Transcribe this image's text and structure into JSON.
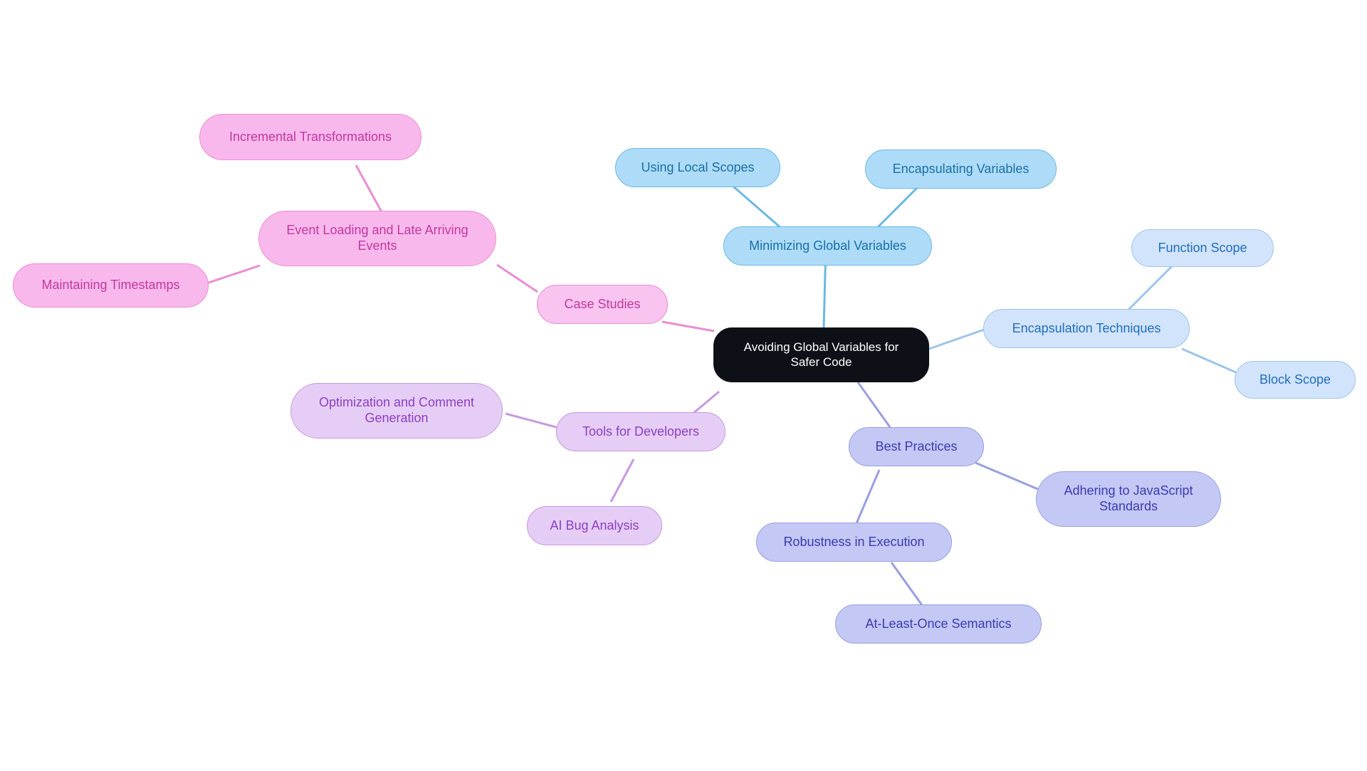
{
  "diagram": {
    "type": "mindmap",
    "title": "Avoiding Global Variables for Safer Code",
    "background": "#ffffff"
  },
  "palette": {
    "root_fill": "#0d1117",
    "root_text": "#ffffff",
    "blue_fill": "#aedcf8",
    "blue_text": "#1a6fa8",
    "blue_border": "#6cb8e4",
    "lightblue_fill": "#d2e4fb",
    "lightblue_text": "#1f6dbd",
    "lightblue_border": "#9dc4ea",
    "indigo_fill": "#c3c8f5",
    "indigo_text": "#3b3bb0",
    "indigo_border": "#9a9fe0",
    "violet_fill": "#e6cdf5",
    "violet_text": "#8b3fc4",
    "violet_border": "#c69ae0",
    "pink_fill": "#f9b8ec",
    "pink_text": "#c0399f",
    "pink_border": "#e88ed2",
    "pink_light_fill": "#f9c4ef",
    "pink_light_text": "#c0399f",
    "pink_light_border": "#e88ed2"
  },
  "nodes": {
    "root": {
      "label": "Avoiding Global Variables for\nSafer Code"
    },
    "minimizing_global_variables": {
      "label": "Minimizing Global Variables"
    },
    "using_local_scopes": {
      "label": "Using Local Scopes"
    },
    "encapsulating_variables": {
      "label": "Encapsulating Variables"
    },
    "encapsulation_techniques": {
      "label": "Encapsulation Techniques"
    },
    "function_scope": {
      "label": "Function Scope"
    },
    "block_scope": {
      "label": "Block Scope"
    },
    "best_practices": {
      "label": "Best Practices"
    },
    "adhering_to_javascript_standards": {
      "label": "Adhering to JavaScript\nStandards"
    },
    "robustness_in_execution": {
      "label": "Robustness in Execution"
    },
    "at_least_once_semantics": {
      "label": "At-Least-Once Semantics"
    },
    "tools_for_developers": {
      "label": "Tools for Developers"
    },
    "optimization_and_comment_generation": {
      "label": "Optimization and Comment\nGeneration"
    },
    "ai_bug_analysis": {
      "label": "AI Bug Analysis"
    },
    "case_studies": {
      "label": "Case Studies"
    },
    "event_loading_and_late_arriving_events": {
      "label": "Event Loading and Late Arriving\nEvents"
    },
    "incremental_transformations": {
      "label": "Incremental Transformations"
    },
    "maintaining_timestamps": {
      "label": "Maintaining Timestamps"
    }
  }
}
